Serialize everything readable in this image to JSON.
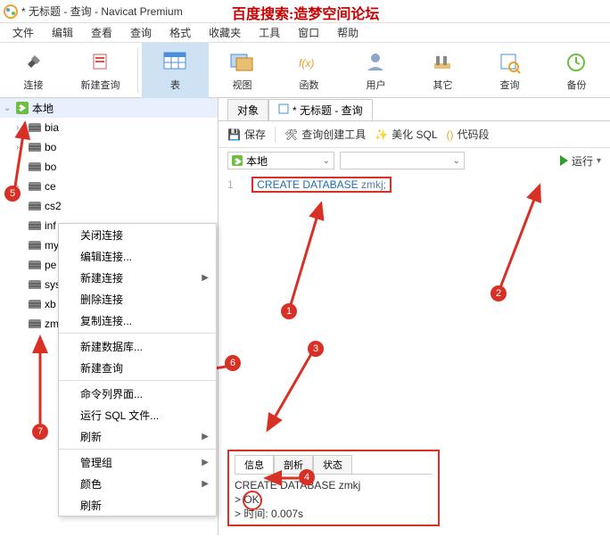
{
  "title": "* 无标题 - 查询 - Navicat Premium",
  "watermark": "百度搜索:造梦空间论坛",
  "menu": [
    "文件",
    "编辑",
    "查看",
    "查询",
    "格式",
    "收藏夹",
    "工具",
    "窗口",
    "帮助"
  ],
  "toolbar": [
    {
      "label": "连接",
      "name": "connect-button"
    },
    {
      "label": "新建查询",
      "name": "new-query-button"
    },
    {
      "label": "表",
      "name": "table-button",
      "active": true
    },
    {
      "label": "视图",
      "name": "view-button"
    },
    {
      "label": "函数",
      "name": "function-button"
    },
    {
      "label": "用户",
      "name": "user-button"
    },
    {
      "label": "其它",
      "name": "other-button"
    },
    {
      "label": "查询",
      "name": "query-button"
    },
    {
      "label": "备份",
      "name": "backup-button"
    }
  ],
  "sidebar": {
    "root": "本地",
    "items": [
      "bia",
      "bo",
      "bo",
      "ce",
      "cs2",
      "inf",
      "my",
      "pe",
      "sys",
      "xb",
      "zm"
    ]
  },
  "context_menu": [
    {
      "label": "关闭连接"
    },
    {
      "label": "编辑连接..."
    },
    {
      "label": "新建连接",
      "sub": true
    },
    {
      "label": "删除连接"
    },
    {
      "label": "复制连接..."
    },
    {
      "sep": true
    },
    {
      "label": "新建数据库..."
    },
    {
      "label": "新建查询"
    },
    {
      "sep": true
    },
    {
      "label": "命令列界面..."
    },
    {
      "label": "运行 SQL 文件..."
    },
    {
      "label": "刷新",
      "sub": true
    },
    {
      "sep": true
    },
    {
      "label": "管理组",
      "sub": true
    },
    {
      "label": "颜色",
      "sub": true
    },
    {
      "label": "刷新"
    }
  ],
  "content": {
    "tabs": [
      {
        "label": "对象"
      },
      {
        "label": "* 无标题 - 查询",
        "active": true
      }
    ],
    "query_toolbar": {
      "save": "保存",
      "builder": "查询创建工具",
      "beautify": "美化 SQL",
      "snippet": "代码段"
    },
    "conn_selector": "本地",
    "run": "运行",
    "sql": {
      "line": "1",
      "kw1": "CREATE",
      "kw2": "DATABASE",
      "ident": "zmkj;"
    },
    "result": {
      "tabs": [
        "信息",
        "剖析",
        "状态"
      ],
      "lines": [
        "CREATE DATABASE zmkj",
        "> OK",
        "> 时间: 0.007s"
      ]
    }
  },
  "annotations": {
    "1": "1",
    "2": "2",
    "3": "3",
    "4": "4",
    "5": "5",
    "6": "6",
    "7": "7"
  },
  "chart_data": null
}
